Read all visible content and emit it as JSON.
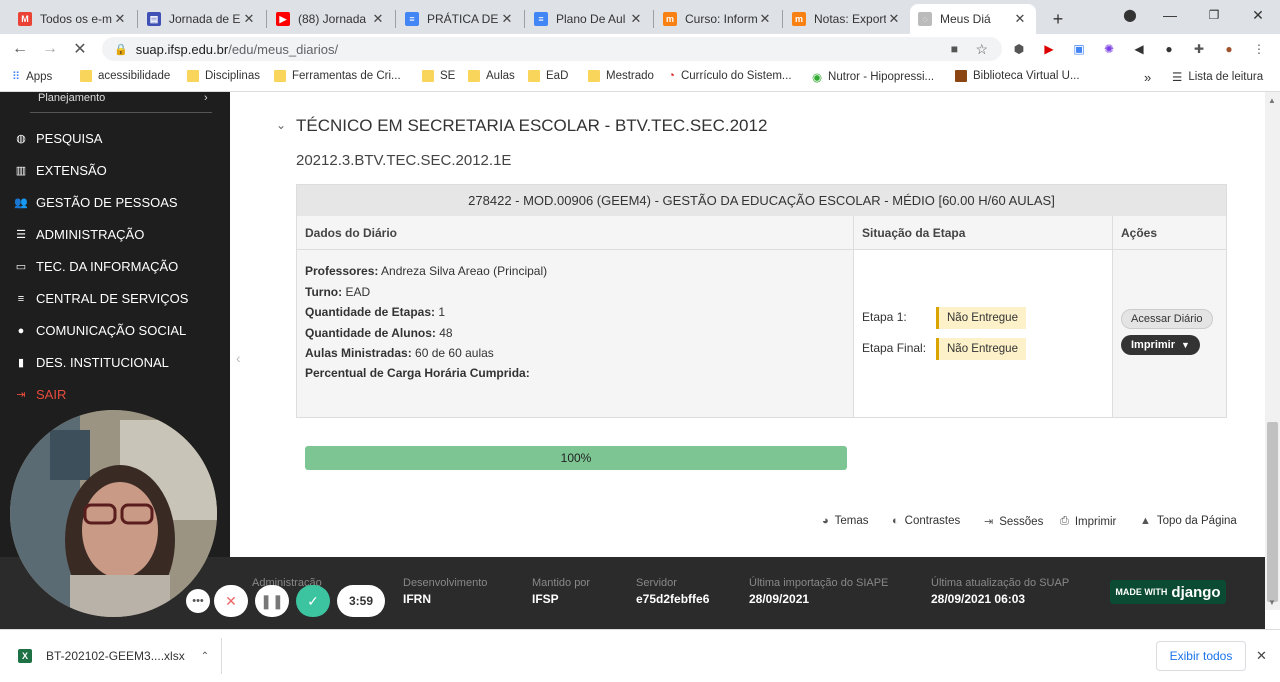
{
  "browser": {
    "tabs": [
      {
        "title": "Todos os e-m",
        "icon": "gmail-icon",
        "color": "#ea4335",
        "glyph": "M"
      },
      {
        "title": "Jornada de Es",
        "icon": "forms-icon",
        "color": "#3f51b5",
        "glyph": "▤"
      },
      {
        "title": "(88) Jornada",
        "icon": "youtube-icon",
        "color": "#ff0000",
        "glyph": "▶"
      },
      {
        "title": "PRÁTICA DE E",
        "icon": "docs-icon",
        "color": "#4285f4",
        "glyph": "≡"
      },
      {
        "title": "Plano De Aul",
        "icon": "docs-icon",
        "color": "#4285f4",
        "glyph": "≡"
      },
      {
        "title": "Curso: Inform",
        "icon": "moodle-icon",
        "color": "#f98012",
        "glyph": "m"
      },
      {
        "title": "Notas: Export",
        "icon": "moodle-icon",
        "color": "#f98012",
        "glyph": "m"
      },
      {
        "title": "Meus Diá",
        "icon": "loading-icon",
        "color": "#bbbbbb",
        "glyph": "◌"
      }
    ],
    "url_host": "suap.ifsp.edu.br",
    "url_path": "/edu/meus_diarios/",
    "bookmarks": [
      {
        "label": "Apps"
      },
      {
        "label": "acessibilidade"
      },
      {
        "label": "Disciplinas"
      },
      {
        "label": "Ferramentas de Cri..."
      },
      {
        "label": "SE"
      },
      {
        "label": "Aulas"
      },
      {
        "label": "EaD"
      },
      {
        "label": "Mestrado"
      },
      {
        "label": "Currículo do Sistem..."
      },
      {
        "label": "Nutror - Hipopressi..."
      },
      {
        "label": "Biblioteca Virtual U..."
      }
    ],
    "reading_list": "Lista de leitura"
  },
  "sidebar": {
    "top_item": "Planejamento",
    "items": [
      {
        "label": "PESQUISA",
        "icon": "globe-icon",
        "glyph": "◍"
      },
      {
        "label": "EXTENSÃO",
        "icon": "building-icon",
        "glyph": "▥"
      },
      {
        "label": "GESTÃO DE PESSOAS",
        "icon": "users-icon",
        "glyph": "👥"
      },
      {
        "label": "ADMINISTRAÇÃO",
        "icon": "list-icon",
        "glyph": "☰"
      },
      {
        "label": "TEC. DA INFORMAÇÃO",
        "icon": "laptop-icon",
        "glyph": "▭"
      },
      {
        "label": "CENTRAL DE SERVIÇOS",
        "icon": "bars-icon",
        "glyph": "≡"
      },
      {
        "label": "COMUNICAÇÃO SOCIAL",
        "icon": "comment-icon",
        "glyph": "●"
      },
      {
        "label": "DES. INSTITUCIONAL",
        "icon": "chart-icon",
        "glyph": "▮"
      },
      {
        "label": "SAIR",
        "icon": "sign-out-icon",
        "glyph": "⇥"
      }
    ],
    "sair_color": "#e74c3c"
  },
  "main": {
    "course_title": "TÉCNICO EM SECRETARIA ESCOLAR - BTV.TEC.SEC.2012",
    "class_code": "20212.3.BTV.TEC.SEC.2012.1E",
    "diary": {
      "title": "278422 - MOD.00906 (GEEM4) - GESTÃO DA EDUCAÇÃO ESCOLAR - MÉDIO [60.00 H/60 AULAS]",
      "col_data": "Dados do Diário",
      "col_stage": "Situação da Etapa",
      "col_actions": "Ações",
      "fields": [
        {
          "label": "Professores:",
          "value": "Andreza Silva Areao (Principal)"
        },
        {
          "label": "Turno:",
          "value": "EAD"
        },
        {
          "label": "Quantidade de Etapas:",
          "value": "1"
        },
        {
          "label": "Quantidade de Alunos:",
          "value": "48"
        },
        {
          "label": "Aulas Ministradas:",
          "value": "60 de 60 aulas"
        }
      ],
      "workload_label": "Percentual de Carga Horária Cumprida:",
      "workload_percent": "100%",
      "workload_fraction": 1.0,
      "stages": [
        {
          "label": "Etapa 1:",
          "status": "Não Entregue"
        },
        {
          "label": "Etapa Final:",
          "status": "Não Entregue"
        }
      ],
      "btn_access": "Acessar Diário",
      "btn_print": "Imprimir"
    },
    "footer_links": [
      {
        "label": "Temas",
        "icon": "palette-icon",
        "glyph": "◕"
      },
      {
        "label": "Contrastes",
        "icon": "contrast-icon",
        "glyph": "◐"
      },
      {
        "label": "Sessões",
        "icon": "sign-in-icon",
        "glyph": "⇥"
      },
      {
        "label": "Imprimir",
        "icon": "print-icon",
        "glyph": "⎙"
      },
      {
        "label": "Topo da Página",
        "icon": "arrow-up-icon",
        "glyph": "▲"
      }
    ]
  },
  "footer": {
    "cols": [
      {
        "label": "Administração",
        "value": ""
      },
      {
        "label": "Desenvolvimento",
        "value": "IFRN"
      },
      {
        "label": "Mantido por",
        "value": "IFSP"
      },
      {
        "label": "Servidor",
        "value": "e75d2febffe6"
      },
      {
        "label": "Última importação do SIAPE",
        "value": "28/09/2021"
      },
      {
        "label": "Última atualização do SUAP",
        "value": "28/09/2021 06:03"
      }
    ],
    "django_prefix": "MADE WITH",
    "django_word": "django"
  },
  "recorder": {
    "timer": "3:59"
  },
  "downloads": {
    "file": "BT-202102-GEEM3....xlsx",
    "show_all": "Exibir todos"
  }
}
